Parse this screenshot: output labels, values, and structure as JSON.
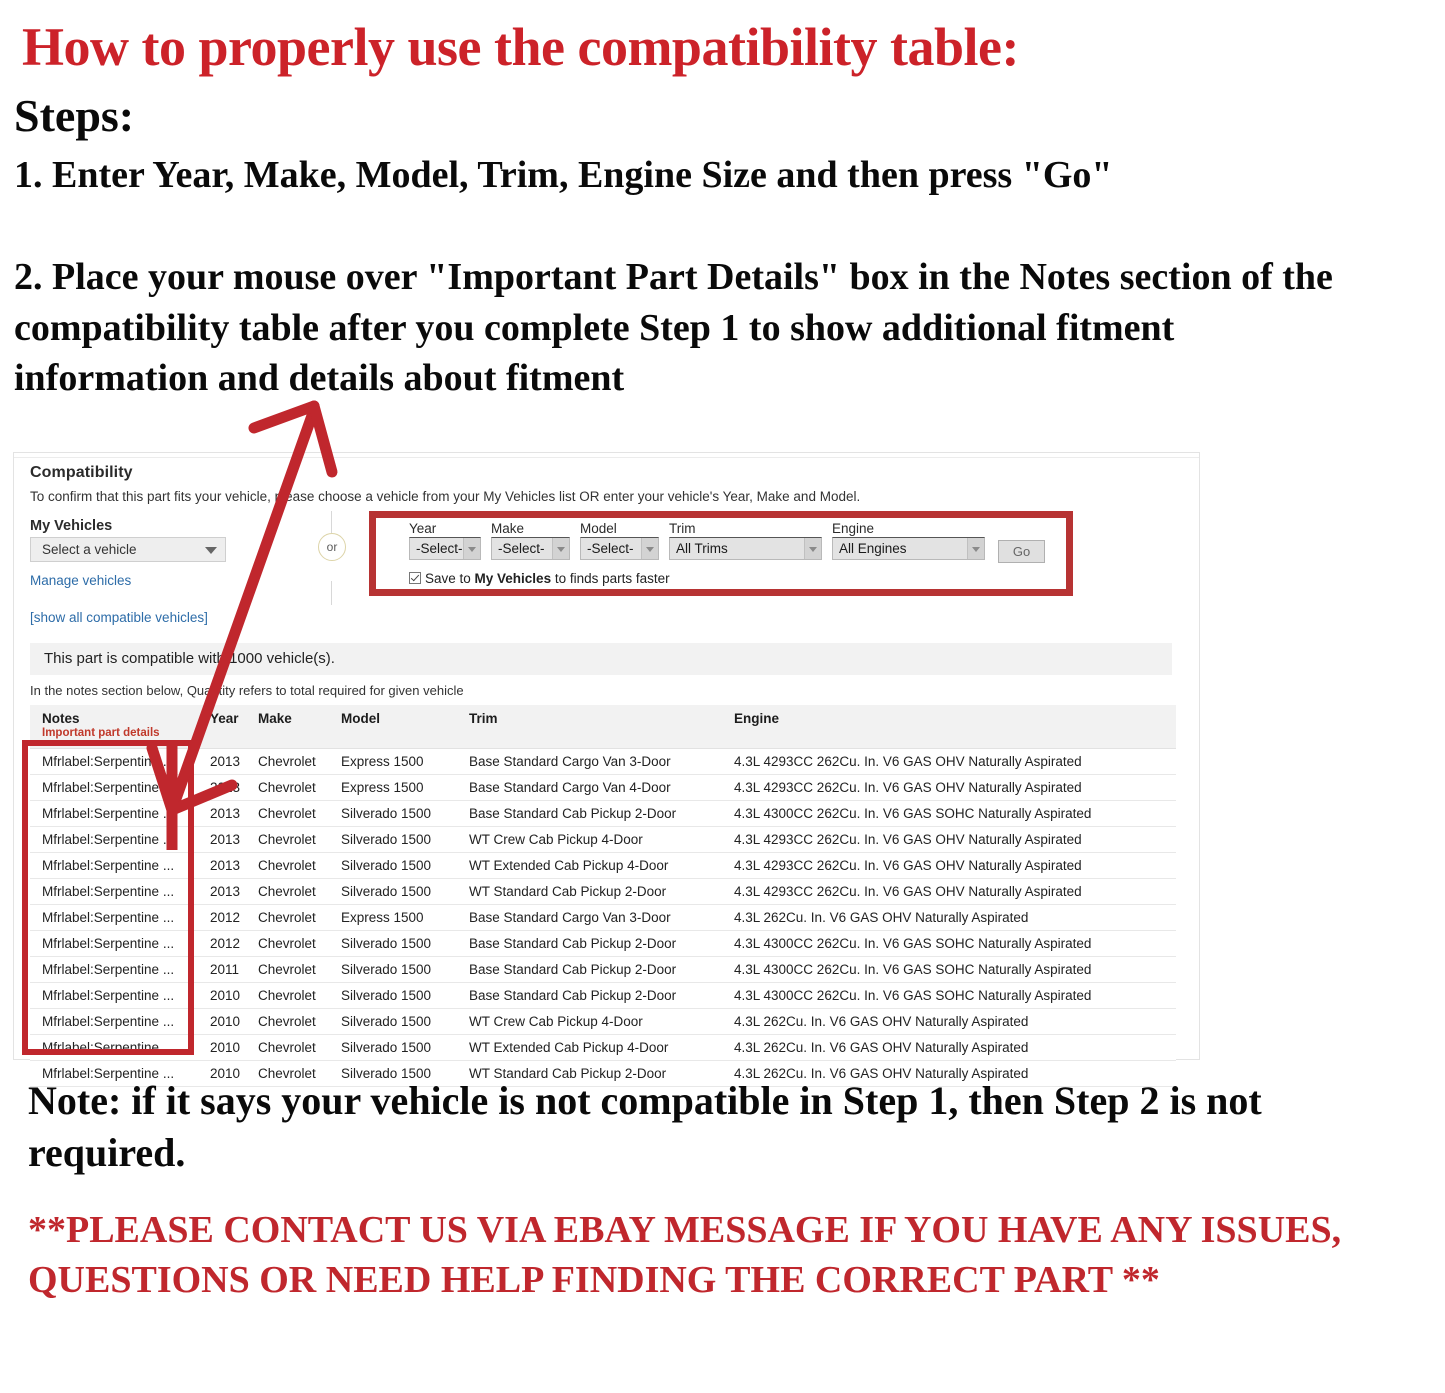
{
  "instructions": {
    "headline": "How to properly use the compatibility table:",
    "steps_label": "Steps:",
    "step_one": "1. Enter Year, Make, Model, Trim, Engine Size and then press \"Go\"",
    "step_two": "2. Place your mouse over \"Important Part Details\" box in the Notes section of the compatibility table after you complete Step 1 to show additional fitment information and details about fitment",
    "note": "Note: if it says your vehicle is not compatible in Step 1, then Step 2 is not required.",
    "contact": "**PLEASE CONTACT US VIA EBAY MESSAGE IF YOU HAVE ANY ISSUES, QUESTIONS OR NEED HELP FINDING THE CORRECT PART **"
  },
  "panel": {
    "title": "Compatibility",
    "subtitle": "To confirm that this part fits your vehicle, please choose a vehicle from your My Vehicles list OR enter your vehicle's Year, Make and Model.",
    "my_vehicles": {
      "label": "My Vehicles",
      "select_value": "Select a vehicle",
      "manage_link": "Manage vehicles",
      "show_all_link": "[show all compatible vehicles]"
    },
    "or_divider": "or",
    "finder": {
      "fields": [
        {
          "label": "Year",
          "value": "-Select-"
        },
        {
          "label": "Make",
          "value": "-Select-"
        },
        {
          "label": "Model",
          "value": "-Select-"
        },
        {
          "label": "Trim",
          "value": "All Trims"
        },
        {
          "label": "Engine",
          "value": "All Engines"
        }
      ],
      "go_label": "Go",
      "save_prefix": "Save to ",
      "save_bold": "My Vehicles",
      "save_suffix": " to finds parts faster",
      "save_checked": true
    },
    "compat_message": "This part is compatible with 1000 vehicle(s).",
    "quantity_note": "In the notes section below, Quantity refers to total required for given vehicle"
  },
  "table": {
    "columns": [
      "Notes",
      "Year",
      "Make",
      "Model",
      "Trim",
      "Engine"
    ],
    "notes_sublabel": "Important part details",
    "rows": [
      {
        "notes": "Mfrlabel:Serpentine ...",
        "year": "2013",
        "make": "Chevrolet",
        "model": "Express 1500",
        "trim": "Base Standard Cargo Van 3-Door",
        "engine": "4.3L 4293CC 262Cu. In. V6 GAS OHV Naturally Aspirated"
      },
      {
        "notes": "Mfrlabel:Serpentine ...",
        "year": "2013",
        "make": "Chevrolet",
        "model": "Express 1500",
        "trim": "Base Standard Cargo Van 4-Door",
        "engine": "4.3L 4293CC 262Cu. In. V6 GAS OHV Naturally Aspirated"
      },
      {
        "notes": "Mfrlabel:Serpentine ...",
        "year": "2013",
        "make": "Chevrolet",
        "model": "Silverado 1500",
        "trim": "Base Standard Cab Pickup 2-Door",
        "engine": "4.3L 4300CC 262Cu. In. V6 GAS SOHC Naturally Aspirated"
      },
      {
        "notes": "Mfrlabel:Serpentine ...",
        "year": "2013",
        "make": "Chevrolet",
        "model": "Silverado 1500",
        "trim": "WT Crew Cab Pickup 4-Door",
        "engine": "4.3L 4293CC 262Cu. In. V6 GAS OHV Naturally Aspirated"
      },
      {
        "notes": "Mfrlabel:Serpentine ...",
        "year": "2013",
        "make": "Chevrolet",
        "model": "Silverado 1500",
        "trim": "WT Extended Cab Pickup 4-Door",
        "engine": "4.3L 4293CC 262Cu. In. V6 GAS OHV Naturally Aspirated"
      },
      {
        "notes": "Mfrlabel:Serpentine ...",
        "year": "2013",
        "make": "Chevrolet",
        "model": "Silverado 1500",
        "trim": "WT Standard Cab Pickup 2-Door",
        "engine": "4.3L 4293CC 262Cu. In. V6 GAS OHV Naturally Aspirated"
      },
      {
        "notes": "Mfrlabel:Serpentine ...",
        "year": "2012",
        "make": "Chevrolet",
        "model": "Express 1500",
        "trim": "Base Standard Cargo Van 3-Door",
        "engine": "4.3L 262Cu. In. V6 GAS OHV Naturally Aspirated"
      },
      {
        "notes": "Mfrlabel:Serpentine ...",
        "year": "2012",
        "make": "Chevrolet",
        "model": "Silverado 1500",
        "trim": "Base Standard Cab Pickup 2-Door",
        "engine": "4.3L 4300CC 262Cu. In. V6 GAS SOHC Naturally Aspirated"
      },
      {
        "notes": "Mfrlabel:Serpentine ...",
        "year": "2011",
        "make": "Chevrolet",
        "model": "Silverado 1500",
        "trim": "Base Standard Cab Pickup 2-Door",
        "engine": "4.3L 4300CC 262Cu. In. V6 GAS SOHC Naturally Aspirated"
      },
      {
        "notes": "Mfrlabel:Serpentine ...",
        "year": "2010",
        "make": "Chevrolet",
        "model": "Silverado 1500",
        "trim": "Base Standard Cab Pickup 2-Door",
        "engine": "4.3L 4300CC 262Cu. In. V6 GAS SOHC Naturally Aspirated"
      },
      {
        "notes": "Mfrlabel:Serpentine ...",
        "year": "2010",
        "make": "Chevrolet",
        "model": "Silverado 1500",
        "trim": "WT Crew Cab Pickup 4-Door",
        "engine": "4.3L 262Cu. In. V6 GAS OHV Naturally Aspirated"
      },
      {
        "notes": "Mfrlabel:Serpentine ...",
        "year": "2010",
        "make": "Chevrolet",
        "model": "Silverado 1500",
        "trim": "WT Extended Cab Pickup 4-Door",
        "engine": "4.3L 262Cu. In. V6 GAS OHV Naturally Aspirated"
      },
      {
        "notes": "Mfrlabel:Serpentine ...",
        "year": "2010",
        "make": "Chevrolet",
        "model": "Silverado 1500",
        "trim": "WT Standard Cab Pickup 2-Door",
        "engine": "4.3L 262Cu. In. V6 GAS OHV Naturally Aspirated"
      }
    ]
  },
  "annotations": {
    "highlight_color": "#b73333",
    "arrow_color": "#c0272d",
    "headline_color": "#cc2229"
  }
}
